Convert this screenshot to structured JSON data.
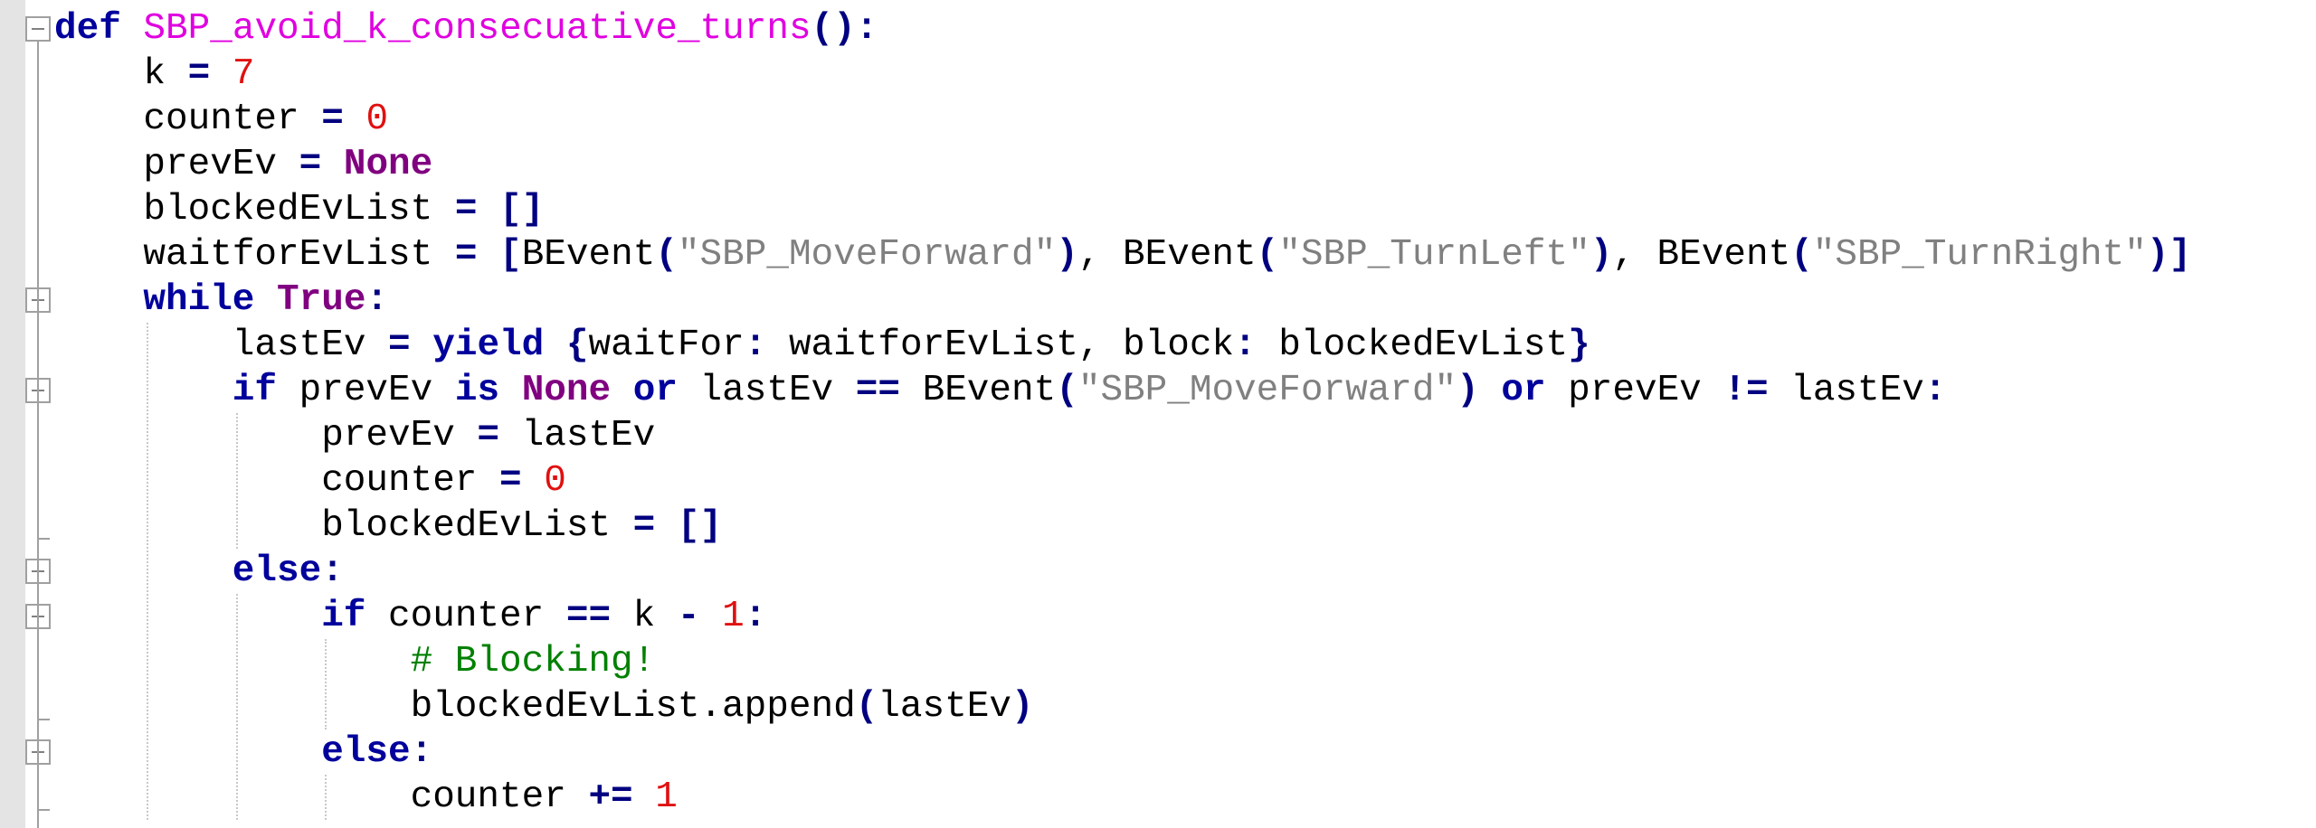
{
  "lines": [
    {
      "indent": 0,
      "tokens": [
        {
          "t": "def",
          "c": "kw"
        },
        {
          "t": " ",
          "c": ""
        },
        {
          "t": "SBP_avoid_k_consecuative_turns",
          "c": "fn"
        },
        {
          "t": "():",
          "c": "op"
        }
      ]
    },
    {
      "indent": 1,
      "tokens": [
        {
          "t": "k ",
          "c": ""
        },
        {
          "t": "=",
          "c": "op"
        },
        {
          "t": " ",
          "c": ""
        },
        {
          "t": "7",
          "c": "num"
        }
      ]
    },
    {
      "indent": 1,
      "tokens": [
        {
          "t": "counter ",
          "c": ""
        },
        {
          "t": "=",
          "c": "op"
        },
        {
          "t": " ",
          "c": ""
        },
        {
          "t": "0",
          "c": "num"
        }
      ]
    },
    {
      "indent": 1,
      "tokens": [
        {
          "t": "prevEv ",
          "c": ""
        },
        {
          "t": "=",
          "c": "op"
        },
        {
          "t": " ",
          "c": ""
        },
        {
          "t": "None",
          "c": "kw2"
        }
      ]
    },
    {
      "indent": 1,
      "tokens": [
        {
          "t": "blockedEvList ",
          "c": ""
        },
        {
          "t": "=",
          "c": "op"
        },
        {
          "t": " ",
          "c": ""
        },
        {
          "t": "[]",
          "c": "op"
        }
      ]
    },
    {
      "indent": 1,
      "tokens": [
        {
          "t": "waitforEvList ",
          "c": ""
        },
        {
          "t": "=",
          "c": "op"
        },
        {
          "t": " ",
          "c": ""
        },
        {
          "t": "[",
          "c": "op"
        },
        {
          "t": "BEvent",
          "c": ""
        },
        {
          "t": "(",
          "c": "op"
        },
        {
          "t": "\"SBP_MoveForward\"",
          "c": "str"
        },
        {
          "t": ")",
          "c": "op"
        },
        {
          "t": ", BEvent",
          "c": ""
        },
        {
          "t": "(",
          "c": "op"
        },
        {
          "t": "\"SBP_TurnLeft\"",
          "c": "str"
        },
        {
          "t": ")",
          "c": "op"
        },
        {
          "t": ", BEvent",
          "c": ""
        },
        {
          "t": "(",
          "c": "op"
        },
        {
          "t": "\"SBP_TurnRight\"",
          "c": "str"
        },
        {
          "t": ")]",
          "c": "op"
        }
      ]
    },
    {
      "indent": 1,
      "tokens": [
        {
          "t": "while",
          "c": "kw"
        },
        {
          "t": " ",
          "c": ""
        },
        {
          "t": "True",
          "c": "kw2"
        },
        {
          "t": ":",
          "c": "op"
        }
      ]
    },
    {
      "indent": 2,
      "tokens": [
        {
          "t": "lastEv ",
          "c": ""
        },
        {
          "t": "=",
          "c": "op"
        },
        {
          "t": " ",
          "c": ""
        },
        {
          "t": "yield",
          "c": "kw"
        },
        {
          "t": " ",
          "c": ""
        },
        {
          "t": "{",
          "c": "op"
        },
        {
          "t": "waitFor",
          "c": ""
        },
        {
          "t": ":",
          "c": "op"
        },
        {
          "t": " waitforEvList, block",
          "c": ""
        },
        {
          "t": ":",
          "c": "op"
        },
        {
          "t": " blockedEvList",
          "c": ""
        },
        {
          "t": "}",
          "c": "op"
        }
      ]
    },
    {
      "indent": 2,
      "tokens": [
        {
          "t": "if",
          "c": "kw"
        },
        {
          "t": " prevEv ",
          "c": ""
        },
        {
          "t": "is",
          "c": "kw"
        },
        {
          "t": " ",
          "c": ""
        },
        {
          "t": "None",
          "c": "kw2"
        },
        {
          "t": " ",
          "c": ""
        },
        {
          "t": "or",
          "c": "kw"
        },
        {
          "t": " lastEv ",
          "c": ""
        },
        {
          "t": "==",
          "c": "op"
        },
        {
          "t": " BEvent",
          "c": ""
        },
        {
          "t": "(",
          "c": "op"
        },
        {
          "t": "\"SBP_MoveForward\"",
          "c": "str"
        },
        {
          "t": ")",
          "c": "op"
        },
        {
          "t": " ",
          "c": ""
        },
        {
          "t": "or",
          "c": "kw"
        },
        {
          "t": " prevEv ",
          "c": ""
        },
        {
          "t": "!=",
          "c": "op"
        },
        {
          "t": " lastEv",
          "c": ""
        },
        {
          "t": ":",
          "c": "op"
        }
      ]
    },
    {
      "indent": 3,
      "tokens": [
        {
          "t": "prevEv ",
          "c": ""
        },
        {
          "t": "=",
          "c": "op"
        },
        {
          "t": " lastEv",
          "c": ""
        }
      ]
    },
    {
      "indent": 3,
      "tokens": [
        {
          "t": "counter ",
          "c": ""
        },
        {
          "t": "=",
          "c": "op"
        },
        {
          "t": " ",
          "c": ""
        },
        {
          "t": "0",
          "c": "num"
        }
      ]
    },
    {
      "indent": 3,
      "tokens": [
        {
          "t": "blockedEvList ",
          "c": ""
        },
        {
          "t": "=",
          "c": "op"
        },
        {
          "t": " ",
          "c": ""
        },
        {
          "t": "[]",
          "c": "op"
        }
      ]
    },
    {
      "indent": 2,
      "tokens": [
        {
          "t": "else",
          "c": "kw"
        },
        {
          "t": ":",
          "c": "op"
        }
      ]
    },
    {
      "indent": 3,
      "tokens": [
        {
          "t": "if",
          "c": "kw"
        },
        {
          "t": " counter ",
          "c": ""
        },
        {
          "t": "==",
          "c": "op"
        },
        {
          "t": " k ",
          "c": ""
        },
        {
          "t": "-",
          "c": "op"
        },
        {
          "t": " ",
          "c": ""
        },
        {
          "t": "1",
          "c": "num"
        },
        {
          "t": ":",
          "c": "op"
        }
      ]
    },
    {
      "indent": 4,
      "tokens": [
        {
          "t": "# Blocking!",
          "c": "cmt"
        }
      ]
    },
    {
      "indent": 4,
      "tokens": [
        {
          "t": "blockedEvList.append",
          "c": ""
        },
        {
          "t": "(",
          "c": "op"
        },
        {
          "t": "lastEv",
          "c": ""
        },
        {
          "t": ")",
          "c": "op"
        }
      ]
    },
    {
      "indent": 3,
      "tokens": [
        {
          "t": "else",
          "c": "kw"
        },
        {
          "t": ":",
          "c": "op"
        }
      ]
    },
    {
      "indent": 4,
      "tokens": [
        {
          "t": "counter ",
          "c": ""
        },
        {
          "t": "+=",
          "c": "op"
        },
        {
          "t": " ",
          "c": ""
        },
        {
          "t": "1",
          "c": "num"
        }
      ]
    }
  ],
  "fold_icons": [
    "minus-fold-icon"
  ],
  "colors": {
    "keyword": "#00009c",
    "builtin": "#800080",
    "function": "#e000e0",
    "number": "#e01010",
    "string": "#808080",
    "comment": "#008000",
    "operator": "#000080"
  }
}
